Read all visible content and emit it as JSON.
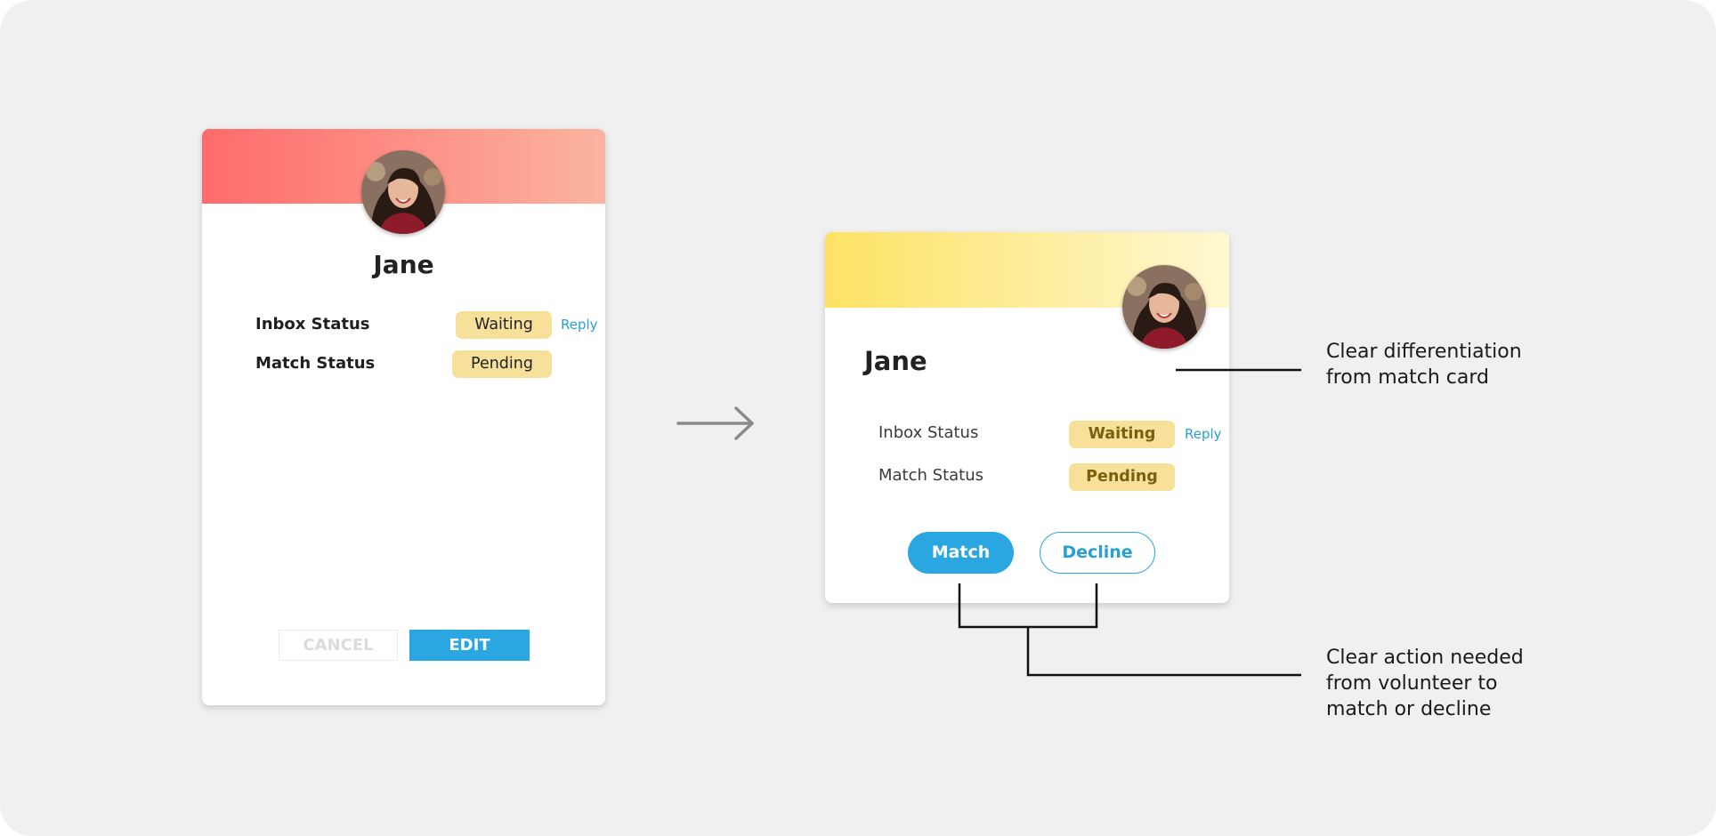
{
  "colors": {
    "background": "#f0f0f0",
    "old_header_gradient": [
      "#ff6b6b",
      "#fbb3a0"
    ],
    "new_header_gradient": [
      "#fde264",
      "#fef8d2"
    ],
    "status_pill": "#f7e09a",
    "accent_blue": "#2aa6e0",
    "reply_link": "#2a9fd6"
  },
  "old_card": {
    "name": "Jane",
    "inbox_status_label": "Inbox Status",
    "inbox_status_value": "Waiting",
    "reply_label": "Reply",
    "match_status_label": "Match Status",
    "match_status_value": "Pending",
    "cancel_label": "CANCEL",
    "edit_label": "EDIT"
  },
  "new_card": {
    "name": "Jane",
    "inbox_status_label": "Inbox Status",
    "inbox_status_value": "Waiting",
    "reply_label": "Reply",
    "match_status_label": "Match Status",
    "match_status_value": "Pending",
    "match_label": "Match",
    "decline_label": "Decline"
  },
  "annotations": {
    "differentiation": "Clear differentiation\nfrom match card",
    "action": "Clear action needed\nfrom volunteer to\nmatch or decline"
  },
  "icons": {
    "transition_arrow": "arrow-right-icon",
    "profile_photo": "avatar-photo"
  }
}
